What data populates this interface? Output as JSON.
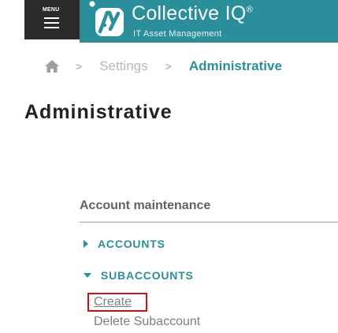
{
  "header": {
    "menu_label": "MENU",
    "logo_title": "Collective IQ",
    "logo_registered": "®",
    "logo_subtitle": "IT Asset Management",
    "brand_color": "#2a8f9a"
  },
  "breadcrumb": {
    "home_icon": "home-icon",
    "separator": ">",
    "items": [
      "Settings",
      "Administrative"
    ]
  },
  "page": {
    "title": "Administrative"
  },
  "section": {
    "heading": "Account maintenance",
    "tree": [
      {
        "label": "ACCOUNTS",
        "expanded": false,
        "icon": "caret-right-icon"
      },
      {
        "label": "SUBACCOUNTS",
        "expanded": true,
        "icon": "caret-down-icon",
        "children": [
          {
            "label": "Create",
            "highlighted": true
          },
          {
            "label": "Delete Subaccount"
          }
        ]
      }
    ]
  },
  "colors": {
    "accent": "#2a8f9a",
    "highlight_border": "#d0101a",
    "menu_bg": "#2a2a2a"
  }
}
